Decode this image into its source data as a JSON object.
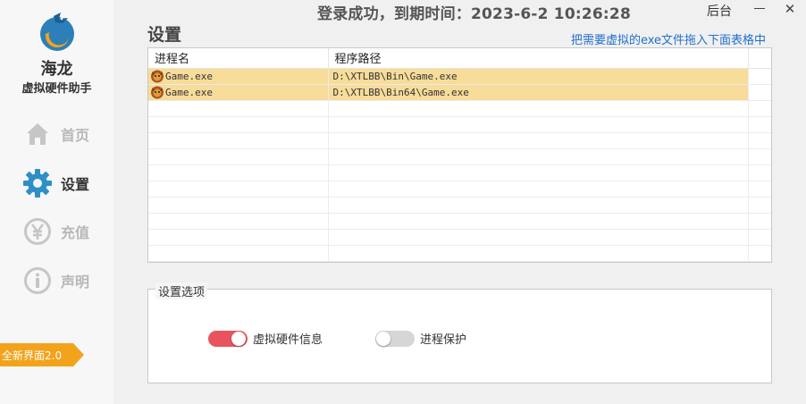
{
  "brand": {
    "name": "海龙",
    "subtitle": "虚拟硬件助手"
  },
  "nav": [
    {
      "label": "首页",
      "icon": "home-icon",
      "active": false
    },
    {
      "label": "设置",
      "icon": "gear-icon",
      "active": true
    },
    {
      "label": "充值",
      "icon": "yen-icon",
      "active": false
    },
    {
      "label": "声明",
      "icon": "info-icon",
      "active": false
    }
  ],
  "version_badge": "全新界面2.0",
  "titlebar": {
    "status": "登录成功，到期时间：2023-6-2 10:26:28",
    "background_label": "后台"
  },
  "page": {
    "title": "设置",
    "drag_hint": "把需要虚拟的exe文件拖入下面表格中"
  },
  "table": {
    "columns": [
      "进程名",
      "程序路径"
    ],
    "rows": [
      {
        "process": "Game.exe",
        "path": "D:\\XTLBB\\Bin\\Game.exe"
      },
      {
        "process": "Game.exe",
        "path": "D:\\XTLBB\\Bin64\\Game.exe"
      }
    ]
  },
  "options": {
    "title": "设置选项",
    "toggles": [
      {
        "label": "虚拟硬件信息",
        "on": true
      },
      {
        "label": "进程保护",
        "on": false
      }
    ]
  },
  "colors": {
    "accent": "#2e8fc7",
    "toggle_on": "#e8545e",
    "toggle_off": "#d6d6d6",
    "row_highlight": "#f7dc9a",
    "badge": "#f2a31b",
    "hint_link": "#1f6fcf"
  }
}
